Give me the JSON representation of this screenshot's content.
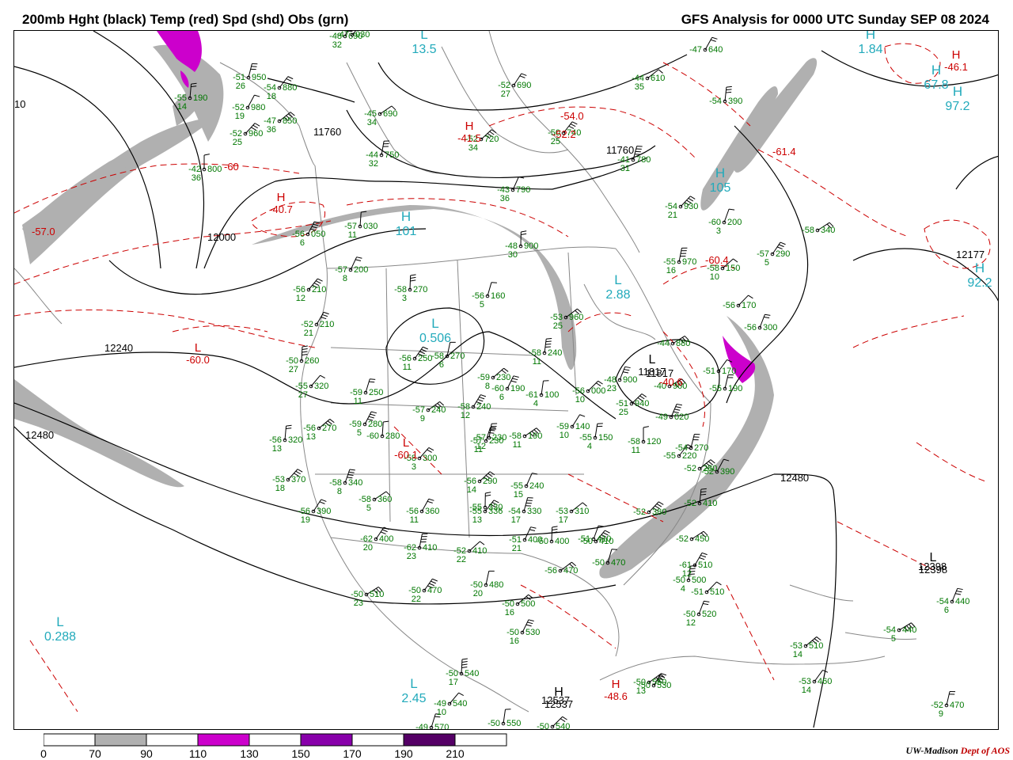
{
  "title_left": "200mb Hght (black) Temp (red) Spd (shd) Obs (grn)",
  "title_right": "GFS Analysis for 0000 UTC Sunday  SEP 08 2024",
  "colors": {
    "height": "#000000",
    "temp": "#cc0000",
    "obs": "#007700",
    "speed_label": "#22aabb",
    "state_lines": "#888888",
    "shade_70_90": "#b0b0b0",
    "shade_110_130": "#cc00cc",
    "shade_150_170": "#8800aa",
    "shade_190_210": "#550066"
  },
  "colorbar": {
    "ticks": [
      "0",
      "70",
      "90",
      "110",
      "130",
      "150",
      "170",
      "190",
      "210"
    ],
    "bins": [
      {
        "fill": "#ffffff"
      },
      {
        "fill": "#b0b0b0"
      },
      {
        "fill": "#ffffff"
      },
      {
        "fill": "#cc00cc"
      },
      {
        "fill": "#ffffff"
      },
      {
        "fill": "#8800aa"
      },
      {
        "fill": "#ffffff"
      },
      {
        "fill": "#550066"
      },
      {
        "fill": "#ffffff"
      }
    ]
  },
  "credit": {
    "org": "UW-Madison",
    "dept": "Dept of AOS"
  },
  "height_labels": [
    "12480",
    "12240",
    "12000",
    "11760",
    "11760",
    "12480",
    "12398",
    "12537",
    "11817",
    "12177",
    "10"
  ],
  "pressure_centers": [
    {
      "type": "H",
      "value": "12537",
      "kind": "height"
    },
    {
      "type": "L",
      "value": "12398",
      "kind": "height"
    },
    {
      "type": "L",
      "value": "11817",
      "kind": "height"
    },
    {
      "type": "L",
      "value": "0.506",
      "kind": "speed"
    },
    {
      "type": "L",
      "value": "2.88",
      "kind": "speed"
    },
    {
      "type": "L",
      "value": "0.288",
      "kind": "speed"
    },
    {
      "type": "L",
      "value": "2.45",
      "kind": "speed"
    },
    {
      "type": "L",
      "value": "13.5",
      "kind": "speed"
    },
    {
      "type": "H",
      "value": "101",
      "kind": "speed"
    },
    {
      "type": "H",
      "value": "105",
      "kind": "speed"
    },
    {
      "type": "H",
      "value": "67.8",
      "kind": "speed"
    },
    {
      "type": "H",
      "value": "97.2",
      "kind": "speed"
    },
    {
      "type": "H",
      "value": "92.2",
      "kind": "speed"
    },
    {
      "type": "H",
      "value": "1.84",
      "kind": "speed"
    },
    {
      "type": "L",
      "value": "-60.0",
      "kind": "temp"
    },
    {
      "type": "H",
      "value": "-40.7",
      "kind": "temp"
    },
    {
      "type": "H",
      "value": "-48.6",
      "kind": "temp"
    },
    {
      "type": "H",
      "value": "-41.5",
      "kind": "temp"
    },
    {
      "type": "L",
      "value": "-60.1",
      "kind": "temp"
    },
    {
      "type": "H",
      "value": "-46.1",
      "kind": "temp"
    }
  ],
  "temp_labels": [
    "-57.0",
    "-60",
    "-60.4",
    "-61.4",
    "-54.0",
    "-52.2",
    "-40.6"
  ],
  "observations": [
    {
      "t": "-42",
      "h": "800",
      "d": "36"
    },
    {
      "t": "-54",
      "h": "880",
      "d": "18"
    },
    {
      "t": "-51",
      "h": "950",
      "d": "26"
    },
    {
      "t": "-47",
      "h": "850",
      "d": "36"
    },
    {
      "t": "-52",
      "h": "980",
      "d": "19"
    },
    {
      "t": "-55",
      "h": "190",
      "d": "14"
    },
    {
      "t": "-52",
      "h": "960",
      "d": "25"
    },
    {
      "t": "-48",
      "h": "690",
      "d": "32"
    },
    {
      "t": "-45",
      "h": "690",
      "d": "34"
    },
    {
      "t": "-52",
      "h": "690",
      "d": "27"
    },
    {
      "t": "-44",
      "h": "750",
      "d": "32"
    },
    {
      "t": "-52",
      "h": "720",
      "d": "34"
    },
    {
      "t": "-43",
      "h": "790",
      "d": "36"
    },
    {
      "t": "-48",
      "h": "900",
      "d": "30"
    },
    {
      "t": "-50",
      "h": "740",
      "d": "25"
    },
    {
      "t": "-41",
      "h": "780",
      "d": "31"
    },
    {
      "t": "-44",
      "h": "610",
      "d": "35"
    },
    {
      "t": "-47",
      "h": "640",
      "d": ""
    },
    {
      "t": "-54",
      "h": "390",
      "d": ""
    },
    {
      "t": "-54",
      "h": "930",
      "d": "21"
    },
    {
      "t": "-60",
      "h": "200",
      "d": "3"
    },
    {
      "t": "-58",
      "h": "340",
      "d": ""
    },
    {
      "t": "-57",
      "h": "290",
      "d": "5"
    },
    {
      "t": "-55",
      "h": "970",
      "d": "16"
    },
    {
      "t": "-58",
      "h": "150",
      "d": "10"
    },
    {
      "t": "-57",
      "h": "200",
      "d": "8"
    },
    {
      "t": "-58",
      "h": "270",
      "d": "3"
    },
    {
      "t": "-56",
      "h": "210",
      "d": "12"
    },
    {
      "t": "-56",
      "h": "160",
      "d": "5"
    },
    {
      "t": "-53",
      "h": "960",
      "d": "25"
    },
    {
      "t": "-52",
      "h": "210",
      "d": "21"
    },
    {
      "t": "-58",
      "h": "240",
      "d": "11"
    },
    {
      "t": "-56",
      "h": "170",
      "d": ""
    },
    {
      "t": "-56",
      "h": "300",
      "d": ""
    },
    {
      "t": "-44",
      "h": "880",
      "d": ""
    },
    {
      "t": "-56",
      "h": "250",
      "d": "11"
    },
    {
      "t": "-58",
      "h": "270",
      "d": "6"
    },
    {
      "t": "-59",
      "h": "230",
      "d": "8"
    },
    {
      "t": "-60",
      "h": "190",
      "d": "6"
    },
    {
      "t": "-50",
      "h": "260",
      "d": "27"
    },
    {
      "t": "-55",
      "h": "320",
      "d": "27"
    },
    {
      "t": "-59",
      "h": "250",
      "d": "11"
    },
    {
      "t": "-57",
      "h": "240",
      "d": "9"
    },
    {
      "t": "-58",
      "h": "240",
      "d": "12"
    },
    {
      "t": "-61",
      "h": "100",
      "d": "4"
    },
    {
      "t": "-56",
      "h": "000",
      "d": "10"
    },
    {
      "t": "-48",
      "h": "900",
      "d": "23"
    },
    {
      "t": "-40",
      "h": "900",
      "d": ""
    },
    {
      "t": "-51",
      "h": "170",
      "d": ""
    },
    {
      "t": "-55",
      "h": "190",
      "d": ""
    },
    {
      "t": "-56",
      "h": "270",
      "d": "13"
    },
    {
      "t": "-59",
      "h": "280",
      "d": "5"
    },
    {
      "t": "-60",
      "h": "280",
      "d": ""
    },
    {
      "t": "-58",
      "h": "300",
      "d": "3"
    },
    {
      "t": "-57",
      "h": "230",
      "d": "11"
    },
    {
      "t": "-58",
      "h": "190",
      "d": "11"
    },
    {
      "t": "-59",
      "h": "140",
      "d": "10"
    },
    {
      "t": "-55",
      "h": "150",
      "d": "4"
    },
    {
      "t": "-51",
      "h": "940",
      "d": "25"
    },
    {
      "t": "-49",
      "h": "020",
      "d": ""
    },
    {
      "t": "-58",
      "h": "120",
      "d": "11"
    },
    {
      "t": "-55",
      "h": "220",
      "d": ""
    },
    {
      "t": "-54",
      "h": "270",
      "d": ""
    },
    {
      "t": "-52",
      "h": "280",
      "d": ""
    },
    {
      "t": "-52",
      "h": "390",
      "d": ""
    },
    {
      "t": "-56",
      "h": "320",
      "d": "13"
    },
    {
      "t": "-53",
      "h": "370",
      "d": "18"
    },
    {
      "t": "-58",
      "h": "340",
      "d": "8"
    },
    {
      "t": "-58",
      "h": "360",
      "d": "5"
    },
    {
      "t": "-56",
      "h": "390",
      "d": "19"
    },
    {
      "t": "-57",
      "h": "230",
      "d": "12"
    },
    {
      "t": "-56",
      "h": "290",
      "d": "14"
    },
    {
      "t": "-55",
      "h": "240",
      "d": "15"
    },
    {
      "t": "-55",
      "h": "330",
      "d": ""
    },
    {
      "t": "-55",
      "h": "336",
      "d": "13"
    },
    {
      "t": "-54",
      "h": "330",
      "d": "17"
    },
    {
      "t": "-53",
      "h": "310",
      "d": "17"
    },
    {
      "t": "-56",
      "h": "360",
      "d": "11"
    },
    {
      "t": "-52",
      "h": "410",
      "d": ""
    },
    {
      "t": "-52",
      "h": "380",
      "d": ""
    },
    {
      "t": "-51",
      "h": "410",
      "d": ""
    },
    {
      "t": "-52",
      "h": "450",
      "d": ""
    },
    {
      "t": "-62",
      "h": "400",
      "d": "20"
    },
    {
      "t": "-62",
      "h": "410",
      "d": "23"
    },
    {
      "t": "-52",
      "h": "410",
      "d": "22"
    },
    {
      "t": "-51",
      "h": "400",
      "d": "21"
    },
    {
      "t": "-50",
      "h": "400",
      "d": ""
    },
    {
      "t": "-50",
      "h": "410",
      "d": ""
    },
    {
      "t": "-50",
      "h": "470",
      "d": ""
    },
    {
      "t": "-56",
      "h": "470",
      "d": ""
    },
    {
      "t": "-61",
      "h": "510",
      "d": "12"
    },
    {
      "t": "-50",
      "h": "500",
      "d": "4"
    },
    {
      "t": "-51",
      "h": "510",
      "d": ""
    },
    {
      "t": "-50",
      "h": "520",
      "d": "12"
    },
    {
      "t": "-50",
      "h": "510",
      "d": "23"
    },
    {
      "t": "-50",
      "h": "470",
      "d": "22"
    },
    {
      "t": "-50",
      "h": "480",
      "d": "20"
    },
    {
      "t": "-50",
      "h": "500",
      "d": "16"
    },
    {
      "t": "-50",
      "h": "530",
      "d": "16"
    },
    {
      "t": "-50",
      "h": "540",
      "d": "17"
    },
    {
      "t": "-49",
      "h": "540",
      "d": "10"
    },
    {
      "t": "-49",
      "h": "570",
      "d": ""
    },
    {
      "t": "-50",
      "h": "550",
      "d": "13"
    },
    {
      "t": "-50",
      "h": "530",
      "d": ""
    },
    {
      "t": "-50",
      "h": "550",
      "d": ""
    },
    {
      "t": "-50",
      "h": "540",
      "d": ""
    },
    {
      "t": "-54",
      "h": "440",
      "d": "6"
    },
    {
      "t": "-54",
      "h": "440",
      "d": "5"
    },
    {
      "t": "-53",
      "h": "460",
      "d": "14"
    },
    {
      "t": "-52",
      "h": "470",
      "d": "9"
    },
    {
      "t": "-53",
      "h": "510",
      "d": "14"
    },
    {
      "t": "-56",
      "h": "050",
      "d": "6"
    },
    {
      "t": "-57",
      "h": "030",
      "d": "11"
    },
    {
      "t": "-47",
      "h": "030",
      "d": ""
    }
  ]
}
